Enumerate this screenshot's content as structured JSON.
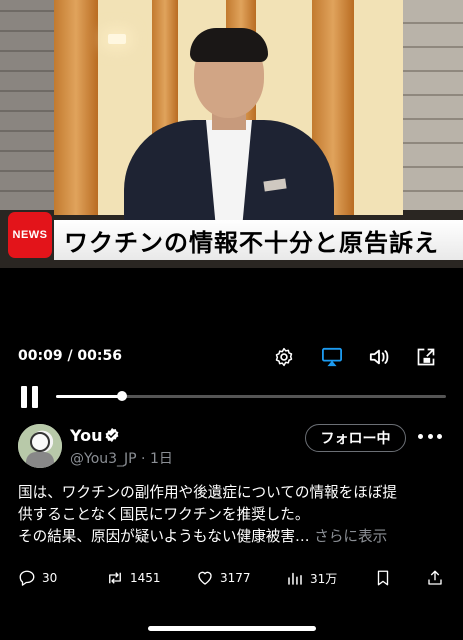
{
  "video": {
    "badge": "NEWS",
    "caption": "ワクチンの情報不十分と原告訴え",
    "time": "00:09 / 00:56",
    "progress_fraction": 0.17
  },
  "controls": {
    "icons": [
      "gear-icon",
      "airplay-icon",
      "volume-icon",
      "pip-icon",
      "pause-icon"
    ]
  },
  "post": {
    "name": "You",
    "handle_line": "@You3_JP · 1日",
    "follow_label": "フォロー中",
    "text_lines": [
      "国は、ワクチンの副作用や後遺症についての情報をほぼ提",
      "供することなく国民にワクチンを推奨した。",
      "その結果、原因が疑いようもない健康被害…"
    ],
    "show_more": "さらに表示"
  },
  "actions": {
    "replies": "30",
    "reposts": "1451",
    "likes": "3177",
    "views": "31万"
  },
  "colors": {
    "accent": "#1d9bf0",
    "news_red": "#e3141a",
    "secondary_text": "#8b8f95"
  }
}
